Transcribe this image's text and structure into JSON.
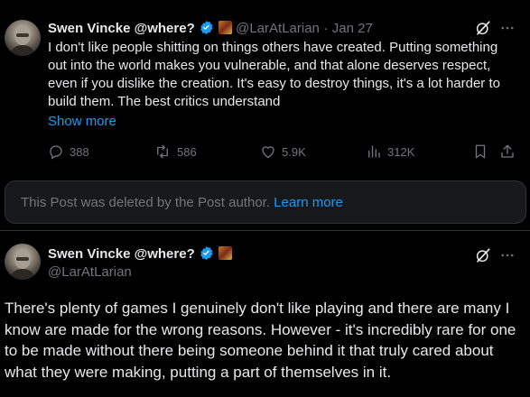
{
  "post1": {
    "author_name": "Swen Vincke @where?",
    "author_handle": "@LarAtLarian",
    "separator": "·",
    "date": "Jan 27",
    "text": "I don't like people shitting on things others have created. Putting something out into the world makes you vulnerable, and that alone deserves respect, even if you dislike the creation. It's easy to destroy things, it's a lot harder to build them. The best critics understand",
    "show_more_label": "Show more",
    "stats": {
      "replies": "388",
      "reposts": "586",
      "likes": "5.9K",
      "views": "312K"
    }
  },
  "deleted_notice": {
    "text": "This Post was deleted by the Post author.",
    "link_label": "Learn more"
  },
  "post2": {
    "author_name": "Swen Vincke @where?",
    "author_handle": "@LarAtLarian",
    "text": "There's plenty of games I genuinely don't like playing and there are many I know are made for the wrong reasons. However - it's incredibly rare for one to be made without there being someone behind it that truly cared about what they were making, putting a part of themselves in it."
  },
  "icons": {
    "verified": "verified-badge-icon",
    "affiliate_flag": "affiliate-flag-icon",
    "grok": "grok-icon",
    "more": "more-options-icon",
    "reply": "reply-icon",
    "repost": "repost-icon",
    "like": "like-icon",
    "views": "views-icon",
    "bookmark": "bookmark-icon",
    "share": "share-icon"
  },
  "colors": {
    "background": "#000000",
    "text": "#e7e9ea",
    "secondary": "#71767b",
    "link": "#1d9bf0",
    "card": "#16181c",
    "border": "#2f3336"
  }
}
